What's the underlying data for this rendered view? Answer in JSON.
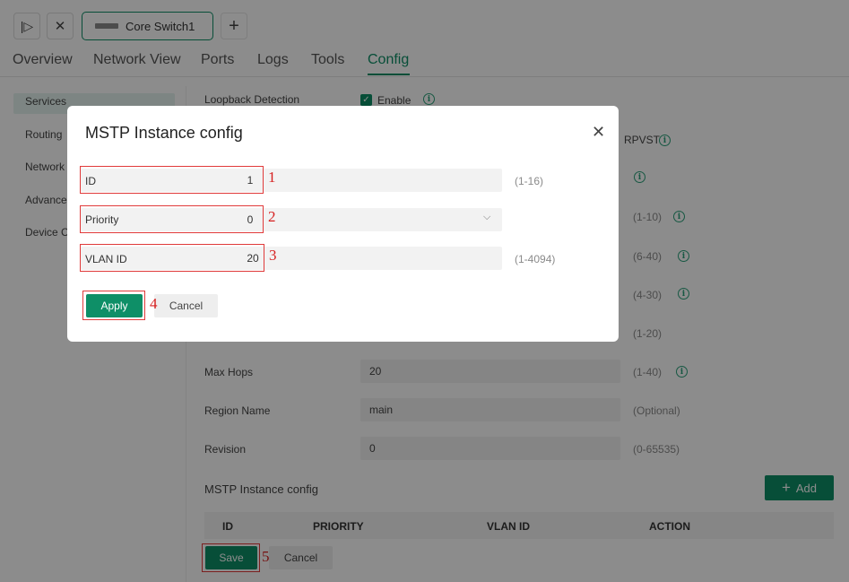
{
  "topbar": {
    "sidebar_toggle_icon": "sidebar-toggle-icon",
    "close_icon": "close-icon",
    "device_tab_label": "Core Switch1",
    "add_icon": "plus-icon"
  },
  "nav": {
    "tabs": [
      "Overview",
      "Network View",
      "Ports",
      "Logs",
      "Tools",
      "Config"
    ],
    "active": "Config"
  },
  "sidebar": {
    "items": [
      "Services",
      "Routing",
      "Network",
      "Advance",
      "Device C"
    ]
  },
  "form": {
    "loopback_label": "Loopback Detection",
    "loopback_enable": "Enable",
    "rpvst_label": "RPVST",
    "ranges": [
      "(1-10)",
      "(6-40)",
      "(4-30)",
      "(1-20)"
    ],
    "max_hops": {
      "label": "Max Hops",
      "value": "20",
      "range": "(1-40)"
    },
    "region_name": {
      "label": "Region Name",
      "value": "main",
      "range": "(Optional)"
    },
    "revision": {
      "label": "Revision",
      "value": "0",
      "range": "(0-65535)"
    },
    "section_title": "MSTP Instance config",
    "add_label": "Add",
    "table_headers": [
      "ID",
      "PRIORITY",
      "VLAN ID",
      "ACTION"
    ],
    "save_label": "Save",
    "cancel_label": "Cancel"
  },
  "modal": {
    "title": "MSTP Instance config",
    "id": {
      "label": "ID",
      "value": "1",
      "range": "(1-16)"
    },
    "priority": {
      "label": "Priority",
      "value": "0"
    },
    "vlan": {
      "label": "VLAN ID",
      "value": "20",
      "range": "(1-4094)"
    },
    "apply_label": "Apply",
    "cancel_label": "Cancel"
  },
  "annotations": [
    "1",
    "2",
    "3",
    "4",
    "5"
  ],
  "colors": {
    "accent": "#0e8f67",
    "annotation": "#d62020"
  }
}
